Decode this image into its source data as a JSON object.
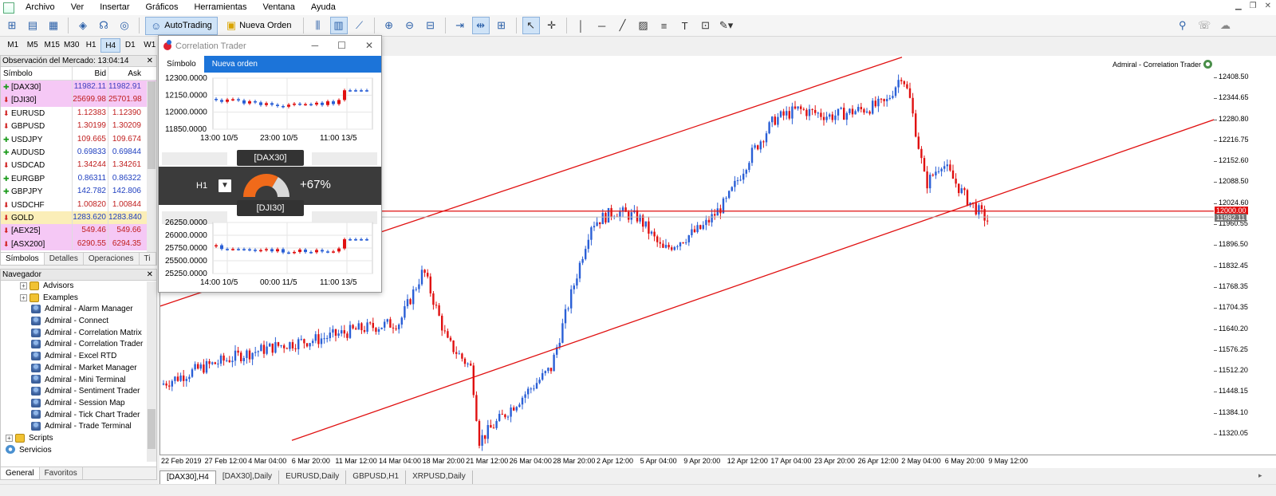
{
  "menu": [
    "Archivo",
    "Ver",
    "Insertar",
    "Gráficos",
    "Herramientas",
    "Ventana",
    "Ayuda"
  ],
  "toolbar": {
    "autotrading": "AutoTrading",
    "new_order": "Nueva Orden"
  },
  "timeframes": [
    "M1",
    "M5",
    "M15",
    "M30",
    "H1",
    "H4",
    "D1",
    "W1"
  ],
  "active_timeframe": "H4",
  "market_watch": {
    "title": "Observación del Mercado: 13:04:14",
    "headers": {
      "symbol": "Símbolo",
      "bid": "Bid",
      "ask": "Ask"
    },
    "rows": [
      {
        "symbol": "[DAX30]",
        "bid": "11982.11",
        "ask": "11982.91",
        "dir": "up",
        "bg": "#f5c8f5",
        "color": "#4040c0"
      },
      {
        "symbol": "[DJI30]",
        "bid": "25699.98",
        "ask": "25701.98",
        "dir": "down",
        "bg": "#f5c8f5",
        "color": "#c02020"
      },
      {
        "symbol": "EURUSD",
        "bid": "1.12383",
        "ask": "1.12390",
        "dir": "down",
        "bg": "#ffffff",
        "color": "#c02020"
      },
      {
        "symbol": "GBPUSD",
        "bid": "1.30199",
        "ask": "1.30209",
        "dir": "down",
        "bg": "#ffffff",
        "color": "#c02020"
      },
      {
        "symbol": "USDJPY",
        "bid": "109.665",
        "ask": "109.674",
        "dir": "up",
        "bg": "#ffffff",
        "color": "#c02020"
      },
      {
        "symbol": "AUDUSD",
        "bid": "0.69833",
        "ask": "0.69844",
        "dir": "up",
        "bg": "#ffffff",
        "color": "#2040c0"
      },
      {
        "symbol": "USDCAD",
        "bid": "1.34244",
        "ask": "1.34261",
        "dir": "down",
        "bg": "#ffffff",
        "color": "#c02020"
      },
      {
        "symbol": "EURGBP",
        "bid": "0.86311",
        "ask": "0.86322",
        "dir": "up",
        "bg": "#ffffff",
        "color": "#2040c0"
      },
      {
        "symbol": "GBPJPY",
        "bid": "142.782",
        "ask": "142.806",
        "dir": "up",
        "bg": "#ffffff",
        "color": "#2040c0"
      },
      {
        "symbol": "USDCHF",
        "bid": "1.00820",
        "ask": "1.00844",
        "dir": "down",
        "bg": "#ffffff",
        "color": "#c02020"
      },
      {
        "symbol": "GOLD",
        "bid": "1283.620",
        "ask": "1283.840",
        "dir": "down",
        "bg": "#fbeeb8",
        "color": "#2040c0"
      },
      {
        "symbol": "[AEX25]",
        "bid": "549.46",
        "ask": "549.66",
        "dir": "down",
        "bg": "#f5c8f5",
        "color": "#c02020"
      },
      {
        "symbol": "[ASX200]",
        "bid": "6290.55",
        "ask": "6294.35",
        "dir": "down",
        "bg": "#f5c8f5",
        "color": "#c02020"
      }
    ],
    "tabs": [
      "Símbolos",
      "Detalles",
      "Operaciones",
      "Ti"
    ]
  },
  "navigator": {
    "title": "Navegador",
    "items": [
      {
        "label": "Advisors",
        "level": 1,
        "icon": "folder",
        "exp": true
      },
      {
        "label": "Examples",
        "level": 1,
        "icon": "folder",
        "exp": true
      },
      {
        "label": "Admiral - Alarm Manager",
        "level": 2,
        "icon": "ea"
      },
      {
        "label": "Admiral - Connect",
        "level": 2,
        "icon": "ea"
      },
      {
        "label": "Admiral - Correlation Matrix",
        "level": 2,
        "icon": "ea"
      },
      {
        "label": "Admiral - Correlation Trader",
        "level": 2,
        "icon": "ea"
      },
      {
        "label": "Admiral - Excel RTD",
        "level": 2,
        "icon": "ea"
      },
      {
        "label": "Admiral - Market Manager",
        "level": 2,
        "icon": "ea"
      },
      {
        "label": "Admiral - Mini Terminal",
        "level": 2,
        "icon": "ea"
      },
      {
        "label": "Admiral - Sentiment Trader",
        "level": 2,
        "icon": "ea"
      },
      {
        "label": "Admiral - Session Map",
        "level": 2,
        "icon": "ea"
      },
      {
        "label": "Admiral - Tick Chart Trader",
        "level": 2,
        "icon": "ea"
      },
      {
        "label": "Admiral - Trade Terminal",
        "level": 2,
        "icon": "ea"
      },
      {
        "label": "Scripts",
        "level": 0,
        "icon": "folder",
        "exp": true
      },
      {
        "label": "Servicios",
        "level": 0,
        "icon": "gear"
      }
    ],
    "tabs": [
      "General",
      "Favoritos"
    ]
  },
  "chart": {
    "ea_label": "Admiral - Correlation Trader",
    "price_labels": [
      "12408.50",
      "12344.65",
      "12280.80",
      "12216.75",
      "12152.60",
      "12088.50",
      "12024.60",
      "11960.55",
      "11896.50",
      "11832.45",
      "11768.35",
      "11704.35",
      "11640.20",
      "11576.25",
      "11512.20",
      "11448.15",
      "11384.10",
      "11320.05"
    ],
    "hline_label": "12000.00",
    "bid_label": "11982.11",
    "time_labels": [
      "22 Feb 2019",
      "27 Feb 12:00",
      "4 Mar 04:00",
      "6 Mar 20:00",
      "11 Mar 12:00",
      "14 Mar 04:00",
      "18 Mar 20:00",
      "21 Mar 12:00",
      "26 Mar 04:00",
      "28 Mar 20:00",
      "2 Apr 12:00",
      "5 Apr 04:00",
      "9 Apr 20:00",
      "12 Apr 12:00",
      "17 Apr 04:00",
      "23 Apr 20:00",
      "26 Apr 12:00",
      "2 May 04:00",
      "6 May 20:00",
      "9 May 12:00"
    ],
    "tabs": [
      "[DAX30],H4",
      "[DAX30],Daily",
      "EURUSD,Daily",
      "GBPUSD,H1",
      "XRPUSD,Daily"
    ],
    "colors": {
      "bull": "#2a5fd6",
      "bear": "#e01010",
      "line": "#e01010"
    }
  },
  "correlation_trader": {
    "title": "Correlation Trader",
    "tabs": [
      "Símbolo",
      "Nueva orden"
    ],
    "symbol_a": "[DAX30]",
    "symbol_b": "[DJI30]",
    "timeframe": "H1",
    "correlation": "+67%",
    "correlation_fraction": 0.67,
    "chart_a": {
      "y_labels": [
        "12300.0000",
        "12150.0000",
        "12000.0000",
        "11850.0000"
      ],
      "x_labels": [
        "13:00 10/5",
        "23:00 10/5",
        "11:00 13/5"
      ]
    },
    "chart_b": {
      "y_labels": [
        "26250.0000",
        "26000.0000",
        "25750.0000",
        "25500.0000",
        "25250.0000"
      ],
      "x_labels": [
        "14:00 10/5",
        "00:00 11/5",
        "11:00 13/5"
      ]
    }
  }
}
